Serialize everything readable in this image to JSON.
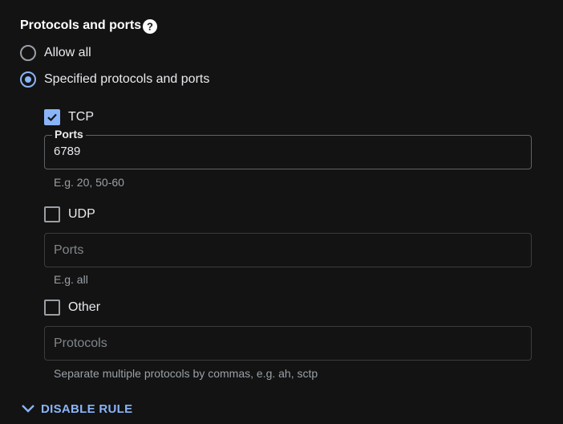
{
  "section": {
    "title": "Protocols and ports"
  },
  "radios": {
    "allow_all": "Allow all",
    "specified": "Specified protocols and ports"
  },
  "tcp": {
    "label": "TCP",
    "field_label": "Ports",
    "value": "6789",
    "hint": "E.g. 20, 50-60"
  },
  "udp": {
    "label": "UDP",
    "placeholder": "Ports",
    "hint": "E.g. all"
  },
  "other": {
    "label": "Other",
    "placeholder": "Protocols",
    "hint": "Separate multiple protocols by commas, e.g. ah, sctp"
  },
  "actions": {
    "disable_rule": "DISABLE RULE"
  },
  "colors": {
    "accent": "#8ab4f8",
    "background": "#131313"
  }
}
